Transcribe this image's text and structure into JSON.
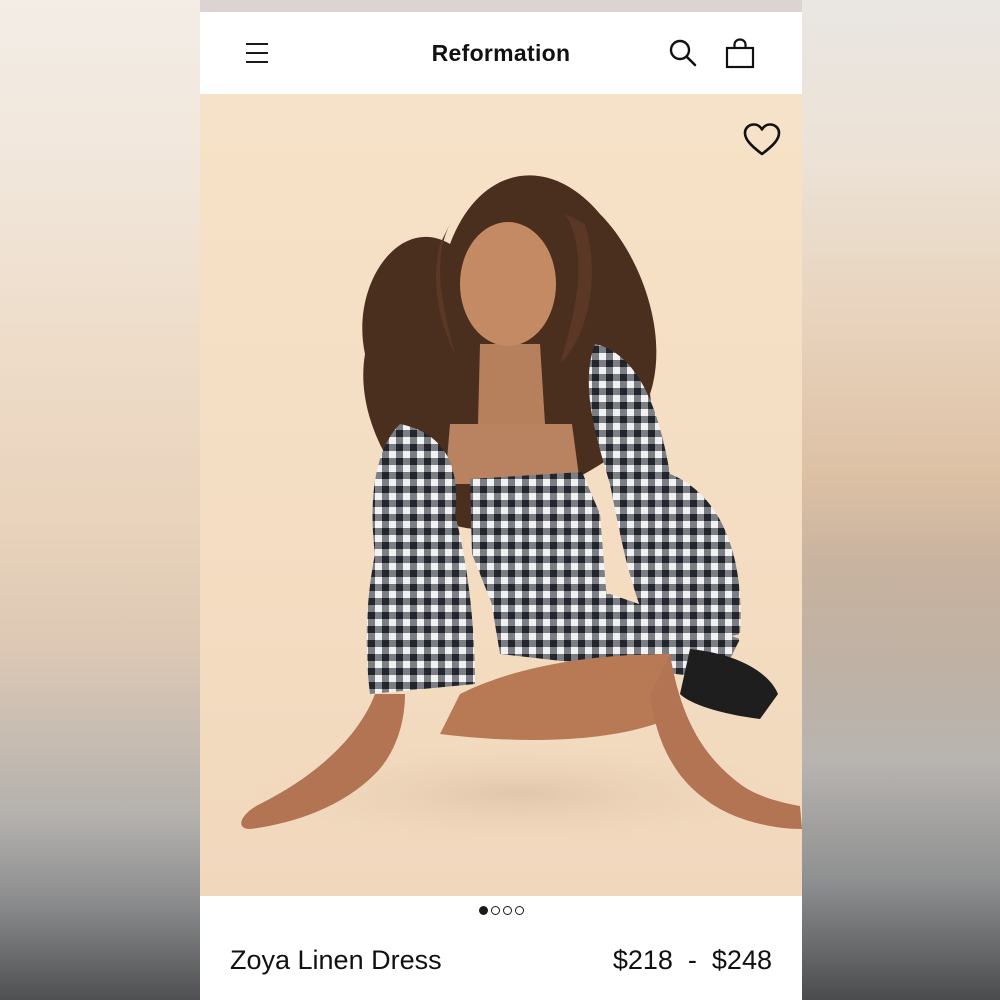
{
  "header": {
    "brand": "Reformation",
    "menu_icon": "hamburger-menu-icon",
    "search_icon": "search-icon",
    "bag_icon": "shopping-bag-icon"
  },
  "product": {
    "image_alt": "Model kneeling in a black and white gingham smocked dress with puff sleeves",
    "favorite_icon": "heart-icon",
    "carousel": {
      "total": 4,
      "active": 1
    },
    "name": "Zoya Linen Dress",
    "price": "$218  -  $248"
  },
  "colors": {
    "background_hero": "#f4ddc2",
    "text": "#111111",
    "accent": "#1a1a1a"
  }
}
